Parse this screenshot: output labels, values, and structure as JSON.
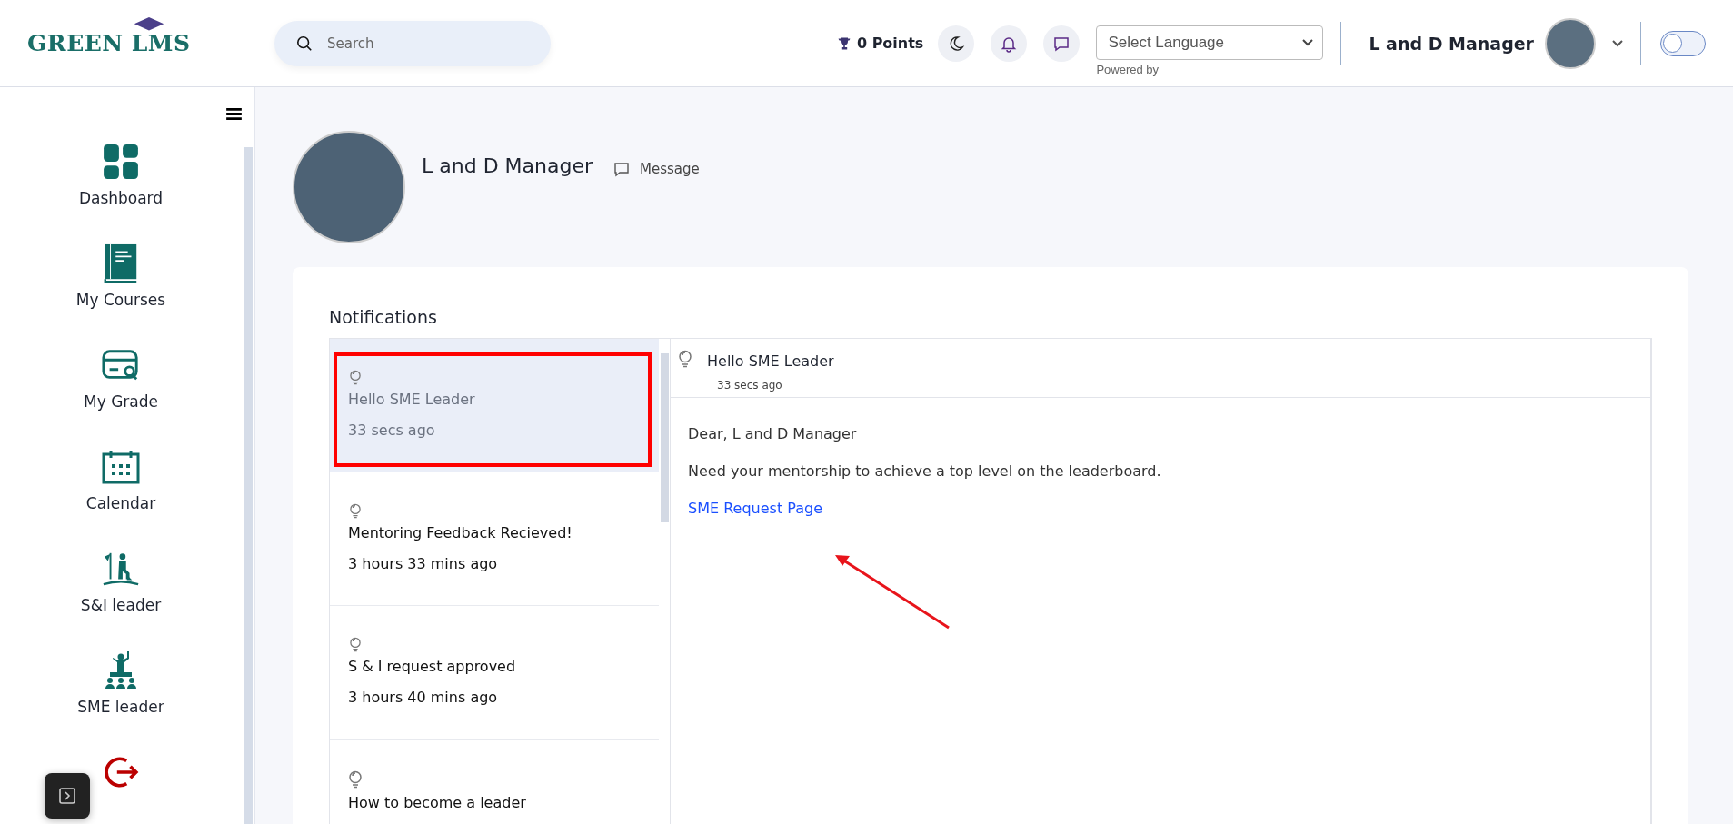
{
  "header": {
    "logo": "GREEN LMS",
    "search": {
      "placeholder": "Search"
    },
    "points": "0 Points",
    "language": {
      "value": "Select Language",
      "note": "Powered by"
    },
    "user_name": "L and D Manager",
    "theme_toggle": {
      "on": false
    }
  },
  "sidebar": {
    "items": [
      {
        "kind": "dashboard",
        "label": "Dashboard"
      },
      {
        "kind": "courses",
        "label": "My Courses"
      },
      {
        "kind": "grade",
        "label": "My Grade"
      },
      {
        "kind": "calendar",
        "label": "Calendar"
      },
      {
        "kind": "climber",
        "label": "S&I leader"
      },
      {
        "kind": "podium",
        "label": "SME leader"
      },
      {
        "kind": "logout"
      }
    ]
  },
  "profile": {
    "name": "L and D Manager",
    "message": "Message"
  },
  "notifications": {
    "title": "Notifications",
    "items": [
      {
        "title": "Hello SME Leader",
        "time": "33 secs ago",
        "selected": true
      },
      {
        "title": "Mentoring Feedback Recieved!",
        "time": "3 hours 33 mins ago",
        "selected": false
      },
      {
        "title": "S & I request approved",
        "time": "3 hours 40 mins ago",
        "selected": false
      },
      {
        "title": "How to become a leader",
        "selected": false
      }
    ],
    "detail": {
      "title": "Hello SME Leader",
      "time": "33 secs ago",
      "greeting": "Dear, L and D Manager",
      "body": "Need your mentorship to achieve a top level on the leaderboard.",
      "link": "SME Request Page"
    }
  }
}
